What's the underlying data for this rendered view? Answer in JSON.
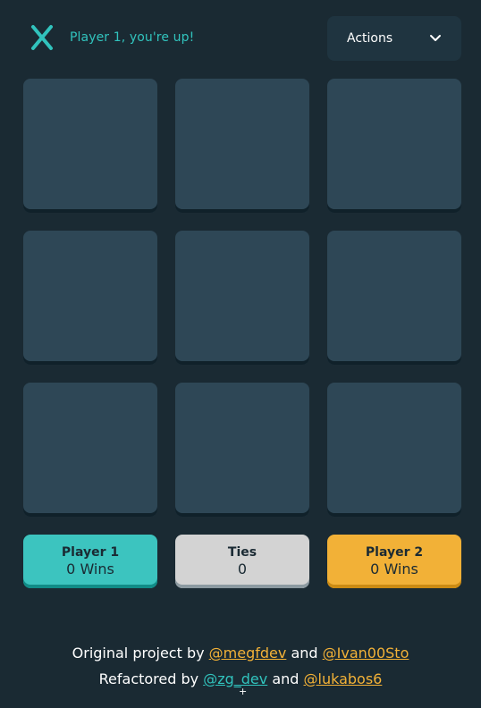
{
  "header": {
    "turn_icon": "x-mark-icon",
    "turn_text": "Player 1, you're up!",
    "actions_label": "Actions",
    "actions_icon": "chevron-down-icon"
  },
  "board": {
    "cells": [
      "",
      "",
      "",
      "",
      "",
      "",
      "",
      "",
      ""
    ]
  },
  "scores": [
    {
      "label": "Player 1",
      "value": "0 Wins"
    },
    {
      "label": "Ties",
      "value": "0"
    },
    {
      "label": "Player 2",
      "value": "0 Wins"
    }
  ],
  "footer": {
    "line1_prefix": "Original project by ",
    "line1_link1": "@megfdev",
    "line1_and": " and ",
    "line1_link2": "@Ivan00Sto",
    "line2_prefix": "Refactored by ",
    "line2_link1": "@zg_dev",
    "line2_and": " and ",
    "line2_link2": "@lukabos6"
  },
  "colors": {
    "background": "#1a2a33",
    "x_color": "#31c3bd",
    "o_color": "#f2b137",
    "tile": "#2e4756",
    "ties": "#a8bfc9"
  }
}
